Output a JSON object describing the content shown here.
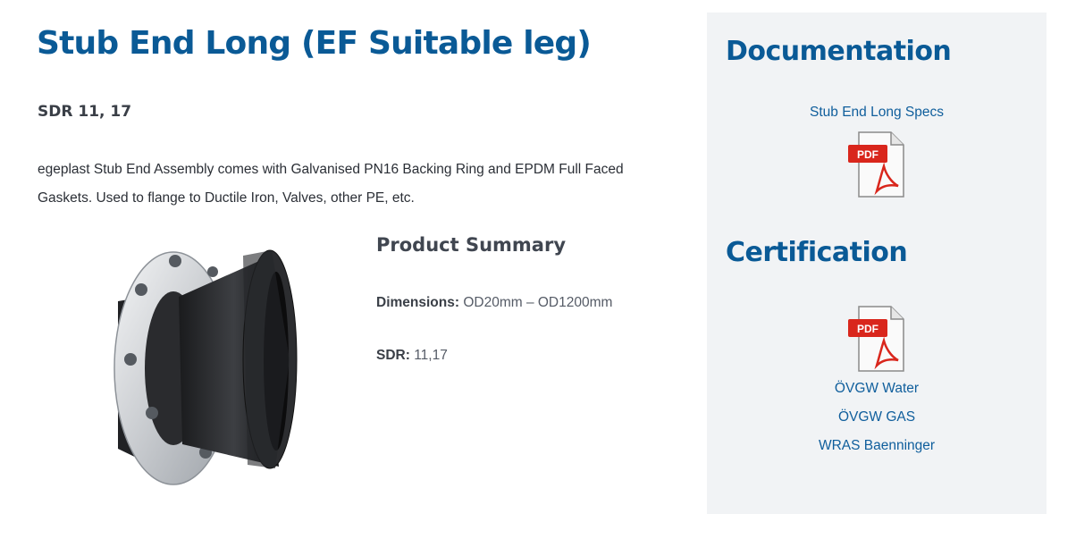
{
  "product": {
    "title": "Stub End Long (EF Suitable leg)",
    "sdr_heading": "SDR 11, 17",
    "description": "egeplast Stub End Assembly comes with Galvanised PN16 Backing Ring and EPDM Full Faced Gaskets. Used to flange to Ductile Iron, Valves, other PE, etc."
  },
  "summary": {
    "title": "Product Summary",
    "dimensions_label": "Dimensions:",
    "dimensions_value": "OD20mm – OD1200mm",
    "sdr_label": "SDR:",
    "sdr_value": "11,17"
  },
  "sidebar": {
    "documentation_heading": "Documentation",
    "documentation_link": "Stub End Long Specs",
    "certification_heading": "Certification",
    "certification_links": [
      "ÖVGW Water",
      "ÖVGW GAS",
      "WRAS Baenninger"
    ],
    "pdf_icon_text": "PDF"
  },
  "colors": {
    "heading_blue": "#0a5a96",
    "link_blue": "#0f5e9c",
    "sidebar_bg": "#f1f3f5",
    "pdf_red": "#d9261c"
  },
  "icons": [
    "pdf-icon",
    "pdf-icon"
  ]
}
